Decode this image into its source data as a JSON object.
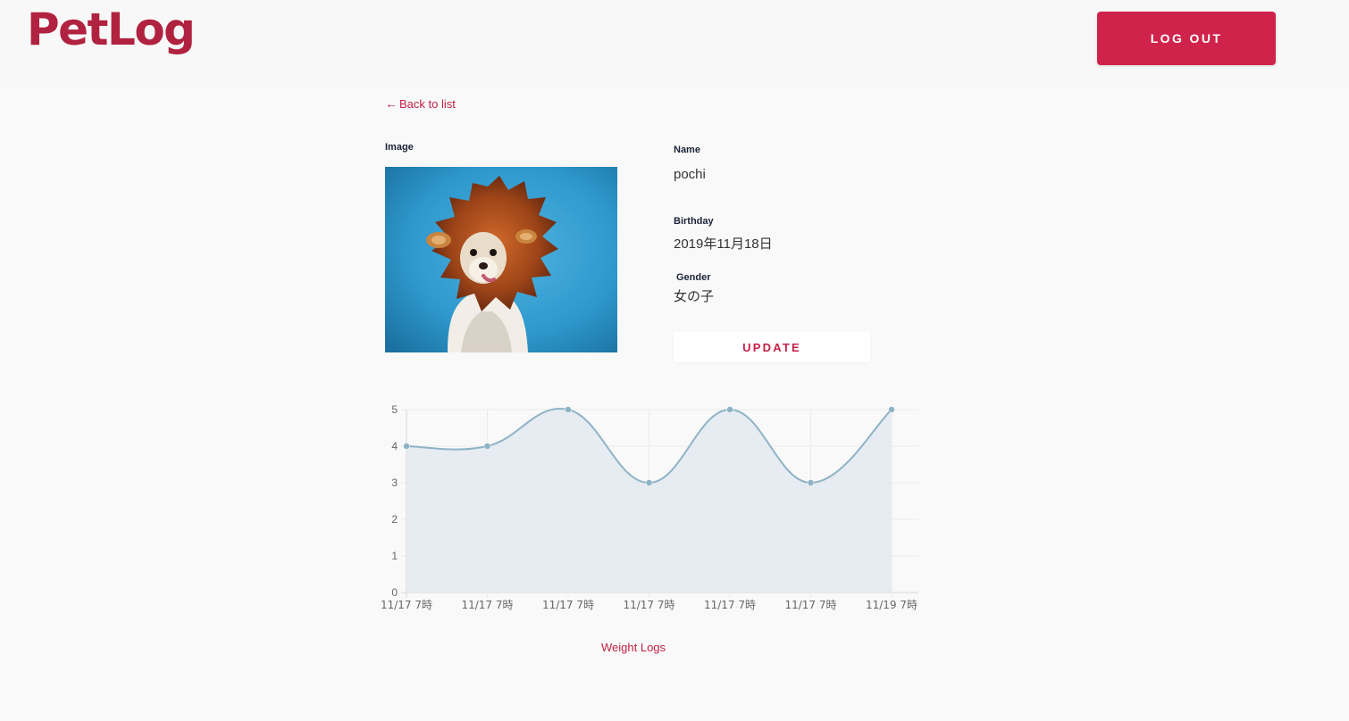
{
  "header": {
    "logo": "PetLog",
    "logout_label": "LOG OUT"
  },
  "nav": {
    "back_arrow": "←",
    "back_label": "Back to list"
  },
  "pet": {
    "image_label": "Image",
    "name_label": "Name",
    "name": "pochi",
    "birthday_label": "Birthday",
    "birthday": "2019年11月18日",
    "gender_label": "Gender",
    "gender": "女の子",
    "update_label": "UPDATE"
  },
  "colors": {
    "brand": "#c42048",
    "line": "#8fb3c6",
    "area": "#e3eaf0"
  },
  "chart_data": {
    "type": "area",
    "x": [
      "11/17 7時",
      "11/17 7時",
      "11/17 7時",
      "11/17 7時",
      "11/17 7時",
      "11/17 7時",
      "11/19 7時"
    ],
    "values": [
      4,
      4,
      5,
      3,
      5,
      3,
      5
    ],
    "yticks": [
      "0",
      "1",
      "2",
      "3",
      "4",
      "5"
    ],
    "ylim": [
      0,
      5
    ],
    "grid": true,
    "curve": "smooth"
  },
  "footer": {
    "weight_logs_label": "Weight Logs"
  }
}
